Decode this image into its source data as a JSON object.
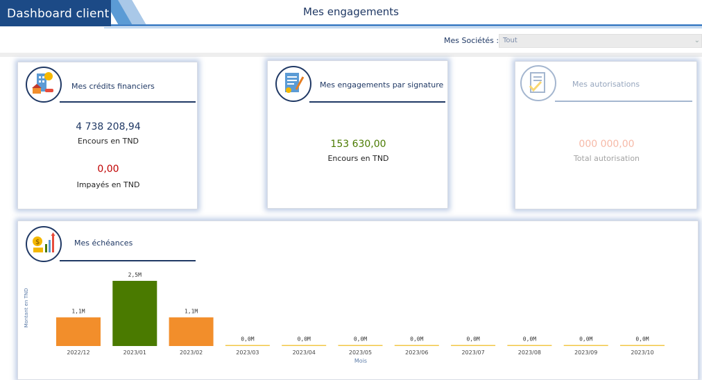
{
  "header": {
    "brand": "Dashboard client",
    "title": "Mes engagements"
  },
  "filter": {
    "label": "Mes Sociétés :",
    "selected": "Tout"
  },
  "cards": {
    "credits": {
      "title": "Mes crédits financiers",
      "value1": "4 738 208,94",
      "label1": "Encours en TND",
      "value2": "0,00",
      "label2": "Impayés en TND"
    },
    "signature": {
      "title": "Mes engagements par signature",
      "value1": "153 630,00",
      "label1": "Encours en TND"
    },
    "autorisations": {
      "title": "Mes autorisations",
      "value1": "000 000,00",
      "label1": "Total autorisation"
    }
  },
  "echeances": {
    "title": "Mes échéances"
  },
  "colors": {
    "brand": "#1c4a86",
    "navy": "#1f3864",
    "green_value": "#4a7a00",
    "red_value": "#c00000",
    "salmon_value": "#f2a07a",
    "bar_orange": "#f28e2b",
    "bar_green": "#4a7a00",
    "zero_line": "#f2c744"
  },
  "chart_data": {
    "type": "bar",
    "xlabel": "Mois",
    "ylabel": "Montant en TND",
    "categories": [
      "2022/12",
      "2023/01",
      "2023/02",
      "2023/03",
      "2023/04",
      "2023/05",
      "2023/06",
      "2023/07",
      "2023/08",
      "2023/09",
      "2023/10"
    ],
    "values": [
      1.1,
      2.5,
      1.1,
      0,
      0,
      0,
      0,
      0,
      0,
      0,
      0
    ],
    "value_unit": "M",
    "data_labels": [
      "1,1M",
      "2,5M",
      "1,1M",
      "0,0M",
      "0,0M",
      "0,0M",
      "0,0M",
      "0,0M",
      "0,0M",
      "0,0M",
      "0,0M"
    ],
    "bar_colors": [
      "#f28e2b",
      "#4a7a00",
      "#f28e2b",
      "#f2c744",
      "#f2c744",
      "#f2c744",
      "#f2c744",
      "#f2c744",
      "#f2c744",
      "#f2c744",
      "#f2c744"
    ],
    "ylim": [
      0,
      2.5
    ],
    "grid": false,
    "legend": "none"
  }
}
